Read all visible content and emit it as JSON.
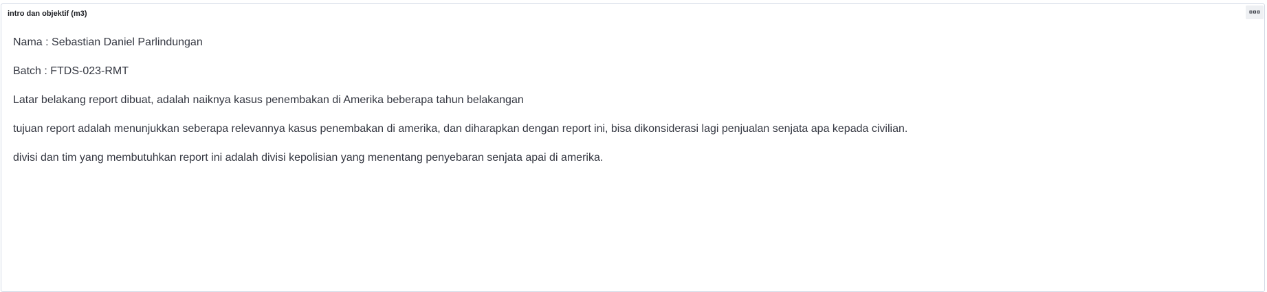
{
  "panel": {
    "title": "intro dan objektif (m3)",
    "menu_icon": "options-dots-icon"
  },
  "content": {
    "paragraphs": [
      "Nama : Sebastian Daniel Parlindungan",
      "Batch : FTDS-023-RMT",
      "Latar belakang report dibuat, adalah naiknya kasus penembakan di Amerika beberapa tahun belakangan",
      "tujuan report adalah menunjukkan seberapa relevannya kasus penembakan di amerika, dan diharapkan dengan report ini, bisa dikonsiderasi lagi penjualan senjata apa kepada civilian.",
      "divisi dan tim yang membutuhkan report ini adalah divisi kepolisian yang menentang penyebaran senjata apai di amerika."
    ]
  },
  "colors": {
    "title": "#1a1c21",
    "text": "#343741",
    "border": "#d3dae6"
  }
}
